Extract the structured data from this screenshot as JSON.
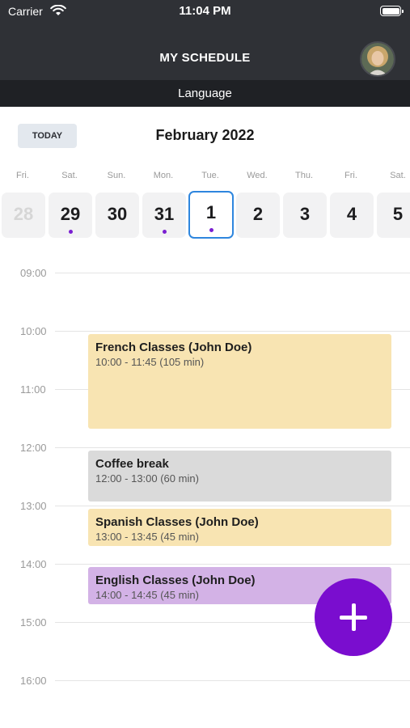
{
  "status_bar": {
    "carrier": "Carrier",
    "time": "11:04 PM"
  },
  "header": {
    "title": "MY SCHEDULE",
    "subtitle": "Language"
  },
  "calendar": {
    "today_label": "TODAY",
    "month": "February 2022",
    "days": [
      {
        "name": "Fri.",
        "num": "28",
        "faded": true,
        "dot": false,
        "selected": false
      },
      {
        "name": "Sat.",
        "num": "29",
        "faded": false,
        "dot": true,
        "selected": false
      },
      {
        "name": "Sun.",
        "num": "30",
        "faded": false,
        "dot": false,
        "selected": false
      },
      {
        "name": "Mon.",
        "num": "31",
        "faded": false,
        "dot": true,
        "selected": false
      },
      {
        "name": "Tue.",
        "num": "1",
        "faded": false,
        "dot": true,
        "selected": true
      },
      {
        "name": "Wed.",
        "num": "2",
        "faded": false,
        "dot": false,
        "selected": false
      },
      {
        "name": "Thu.",
        "num": "3",
        "faded": false,
        "dot": false,
        "selected": false
      },
      {
        "name": "Fri.",
        "num": "4",
        "faded": false,
        "dot": false,
        "selected": false
      },
      {
        "name": "Sat.",
        "num": "5",
        "faded": false,
        "dot": false,
        "selected": false
      }
    ]
  },
  "timeline": {
    "hours": [
      "09:00",
      "10:00",
      "11:00",
      "12:00",
      "13:00",
      "14:00",
      "15:00",
      "16:00"
    ],
    "events": [
      {
        "title": "French Classes (John Doe)",
        "time": "10:00 - 11:45 (105 min)",
        "color": "#f8e4b2"
      },
      {
        "title": "Coffee break",
        "time": "12:00 - 13:00 (60 min)",
        "color": "#dadada"
      },
      {
        "title": "Spanish Classes (John Doe)",
        "time": "13:00 - 13:45 (45 min)",
        "color": "#f8e4b2"
      },
      {
        "title": "English Classes (John Doe)",
        "time": "14:00 - 14:45 (45 min)",
        "color": "#d3b2e6"
      }
    ]
  },
  "colors": {
    "accent": "#7a0dcf",
    "selected_border": "#2e86de",
    "header_bg": "#2f3136"
  },
  "fab": {
    "icon": "plus-icon"
  }
}
